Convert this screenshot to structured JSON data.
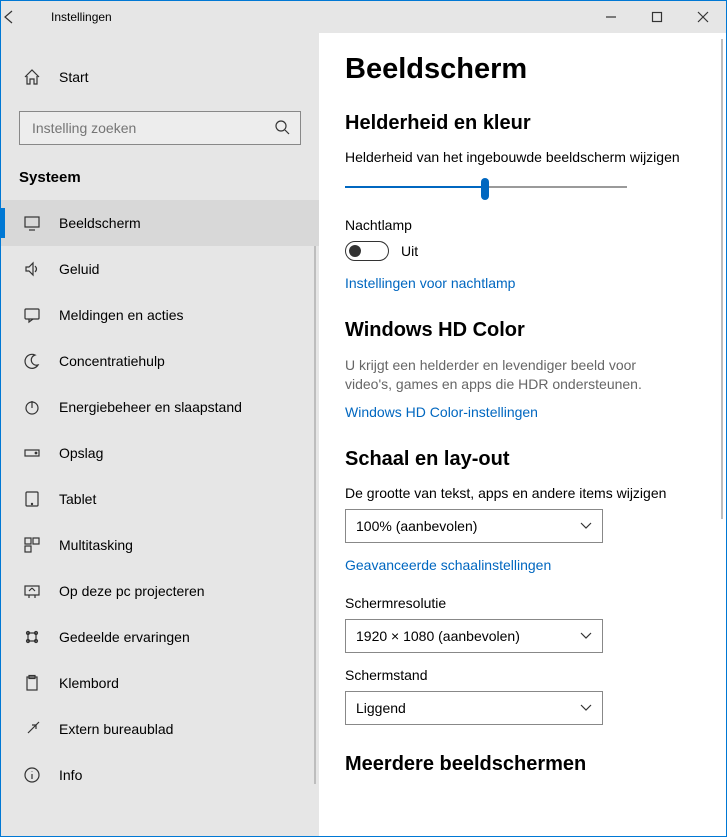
{
  "window": {
    "title": "Instellingen"
  },
  "sidebar": {
    "home": "Start",
    "search_placeholder": "Instelling zoeken",
    "section": "Systeem",
    "items": [
      {
        "label": "Beeldscherm",
        "selected": true,
        "icon": "monitor"
      },
      {
        "label": "Geluid",
        "icon": "sound"
      },
      {
        "label": "Meldingen en acties",
        "icon": "chat"
      },
      {
        "label": "Concentratiehulp",
        "icon": "moon"
      },
      {
        "label": "Energiebeheer en slaapstand",
        "icon": "power"
      },
      {
        "label": "Opslag",
        "icon": "storage"
      },
      {
        "label": "Tablet",
        "icon": "tablet"
      },
      {
        "label": "Multitasking",
        "icon": "multitask"
      },
      {
        "label": "Op deze pc projecteren",
        "icon": "project"
      },
      {
        "label": "Gedeelde ervaringen",
        "icon": "share"
      },
      {
        "label": "Klembord",
        "icon": "clipboard"
      },
      {
        "label": "Extern bureaublad",
        "icon": "remote"
      },
      {
        "label": "Info",
        "icon": "info"
      }
    ]
  },
  "page": {
    "title": "Beeldscherm",
    "brightness_section": "Helderheid en kleur",
    "brightness_label": "Helderheid van het ingebouwde beeldscherm wijzigen",
    "nightlight_label": "Nachtlamp",
    "nightlight_state": "Uit",
    "nightlight_link": "Instellingen voor nachtlamp",
    "hdcolor_title": "Windows HD Color",
    "hdcolor_desc": "U krijgt een helderder en levendiger beeld voor video's, games en apps die HDR ondersteunen.",
    "hdcolor_link": "Windows HD Color-instellingen",
    "scale_title": "Schaal en lay-out",
    "scale_label": "De grootte van tekst, apps en andere items wijzigen",
    "scale_value": "100% (aanbevolen)",
    "scale_link": "Geavanceerde schaalinstellingen",
    "resolution_label": "Schermresolutie",
    "resolution_value": "1920 × 1080 (aanbevolen)",
    "orientation_label": "Schermstand",
    "orientation_value": "Liggend",
    "multi_title": "Meerdere beeldschermen"
  }
}
